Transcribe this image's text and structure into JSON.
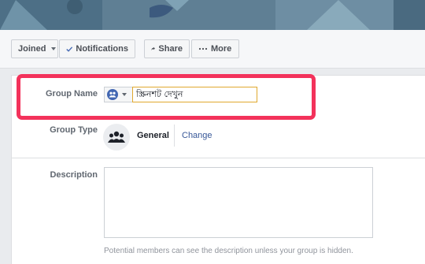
{
  "toolbar": {
    "joined_label": "Joined",
    "notifications_label": "Notifications",
    "share_label": "Share",
    "more_label": "More"
  },
  "form": {
    "group_name_label": "Group Name",
    "group_name_value": "স্ক্রিনশট দেখুন",
    "group_type_label": "Group Type",
    "group_type_value": "General",
    "change_label": "Change",
    "description_label": "Description",
    "description_value": "",
    "description_hint": "Potential members can see the description unless your group is hidden."
  },
  "icons": {
    "joined": "caret-down-icon",
    "notifications": "checkmark-icon",
    "share": "share-arrow-icon",
    "more": "ellipsis-icon",
    "privacy": "group-privacy-icon",
    "group_type": "group-people-icon"
  },
  "colors": {
    "highlight": "#f3325b",
    "link": "#385898",
    "accent": "#4267b2",
    "input_focus_border": "#e0a82e"
  }
}
